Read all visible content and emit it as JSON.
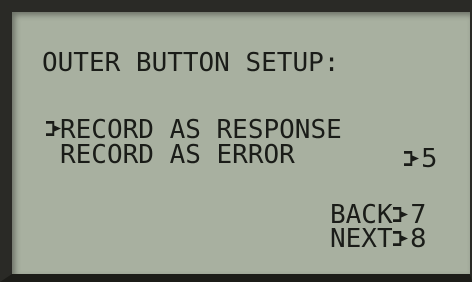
{
  "screen": {
    "title": "OUTER BUTTON SETUP:",
    "options": [
      {
        "label": "RECORD AS RESPONSE",
        "selected": true,
        "key": ""
      },
      {
        "label": "RECORD AS ERROR",
        "selected": false,
        "key": "5"
      }
    ],
    "nav": {
      "back_label": "BACK",
      "back_key": "7",
      "next_label": "NEXT",
      "next_key": "8"
    },
    "icons": {
      "selector": "selection-arrow-icon",
      "key_indicator": "key-arrow-icon"
    },
    "colors": {
      "lcd_background": "#a8b0a0",
      "lcd_text": "#1a1c18",
      "bezel": "#2a2a26"
    }
  }
}
